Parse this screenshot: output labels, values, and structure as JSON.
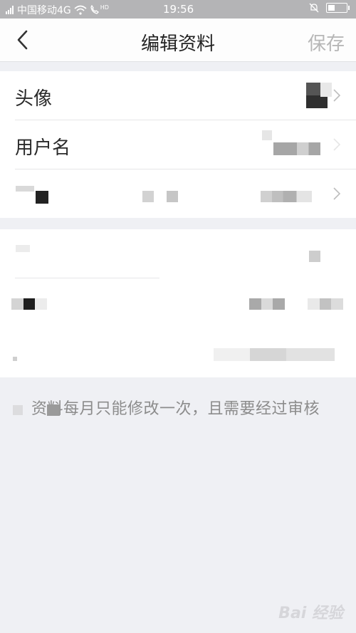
{
  "status_bar": {
    "carrier": "中国移动4G",
    "hd": "HD",
    "time": "19:56"
  },
  "nav": {
    "title": "编辑资料",
    "save_label": "保存"
  },
  "profile_group": {
    "avatar_label": "头像",
    "username_label": "用户名"
  },
  "hint_text": "资料每月只能修改一次，且需要经过审核",
  "watermark": "Bai 经验"
}
